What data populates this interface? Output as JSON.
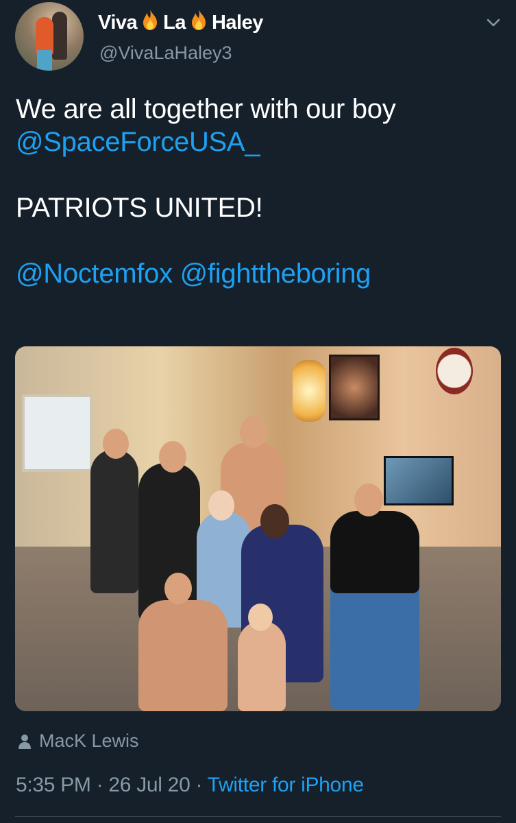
{
  "author": {
    "name_part1": "Viva",
    "name_part2": "La",
    "name_part3": "Haley",
    "handle": "@VivaLaHaley3",
    "name_emoji": "fire-emoji"
  },
  "tweet": {
    "text_line1": "We are all together with our boy",
    "mention1": "@SpaceForceUSA_",
    "text_line2": "PATRIOTS UNITED!",
    "mention2": "@Noctemfox",
    "mention3": "@fighttheboring"
  },
  "media": {
    "tagged_user": "MacK Lewis"
  },
  "meta": {
    "time": "5:35 PM",
    "sep1": " · ",
    "date": "26 Jul 20",
    "sep2": " · ",
    "source": "Twitter for iPhone"
  },
  "colors": {
    "background": "#15202b",
    "link": "#1da1f2",
    "secondary_text": "#8899a6"
  },
  "icons": {
    "menu": "chevron-down-icon",
    "tag": "person-icon"
  }
}
